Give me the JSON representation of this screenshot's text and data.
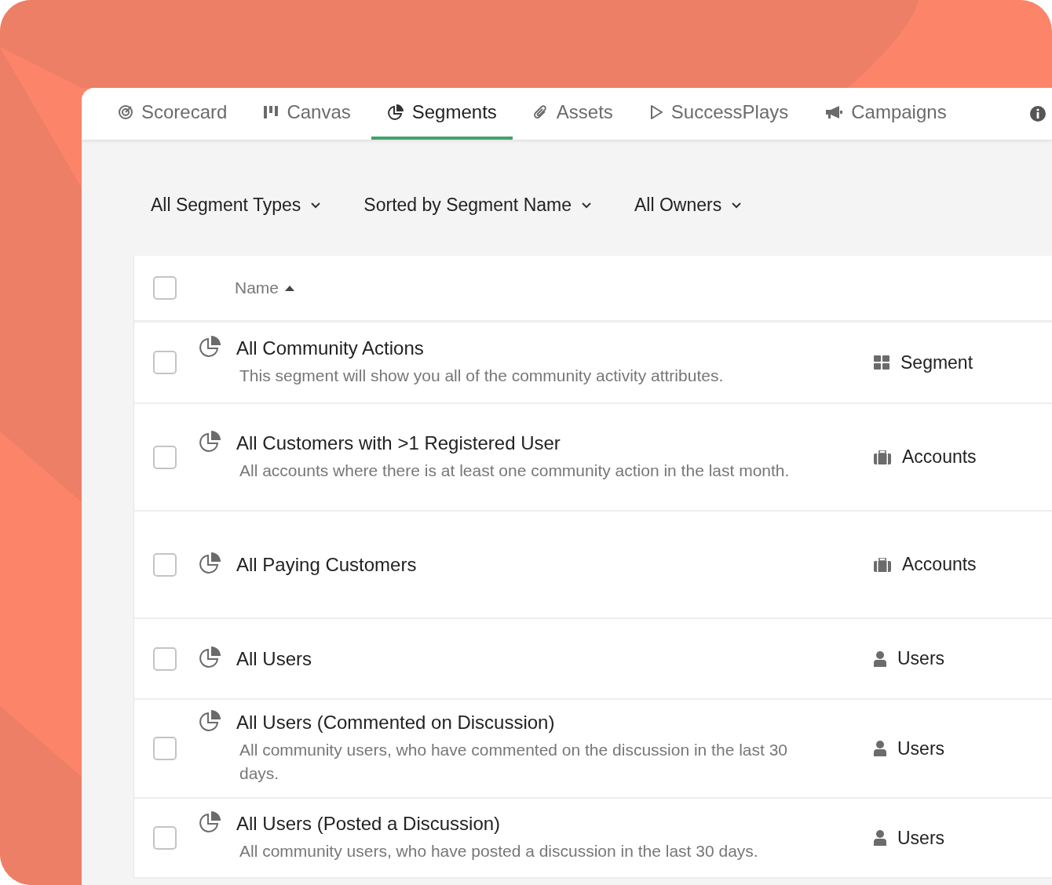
{
  "tabs": [
    {
      "label": "Scorecard",
      "selected": false
    },
    {
      "label": "Canvas",
      "selected": false
    },
    {
      "label": "Segments",
      "selected": true
    },
    {
      "label": "Assets",
      "selected": false
    },
    {
      "label": "SuccessPlays",
      "selected": false
    },
    {
      "label": "Campaigns",
      "selected": false
    }
  ],
  "filters": [
    "All Segment Types",
    "Sorted by Segment Name",
    "All Owners"
  ],
  "table": {
    "header": {
      "checked": false,
      "name": "Name"
    },
    "rows": [
      {
        "checked": false,
        "name": "All Community Actions",
        "description": "This segment will show you all of the community activity attributes.",
        "kind": "segment",
        "type": "Segment"
      },
      {
        "checked": false,
        "name": "All Customers with >1 Registered User",
        "description": "All accounts where there is at least one community action in the last month.",
        "kind": "accounts",
        "type": "Accounts"
      },
      {
        "checked": false,
        "name": "All Paying Customers",
        "kind": "accounts",
        "type": "Accounts"
      },
      {
        "checked": false,
        "name": "All Users",
        "kind": "users",
        "type": "Users"
      },
      {
        "checked": false,
        "name": "All Users (Commented on Discussion)",
        "description": "All community users, who have commented on the discussion in the last 30 days.",
        "kind": "users",
        "type": "Users"
      },
      {
        "checked": false,
        "name": "All Users (Posted a Discussion)",
        "description": "All community users, who have posted a discussion in the last 30 days.",
        "kind": "users",
        "type": "Users"
      }
    ]
  }
}
